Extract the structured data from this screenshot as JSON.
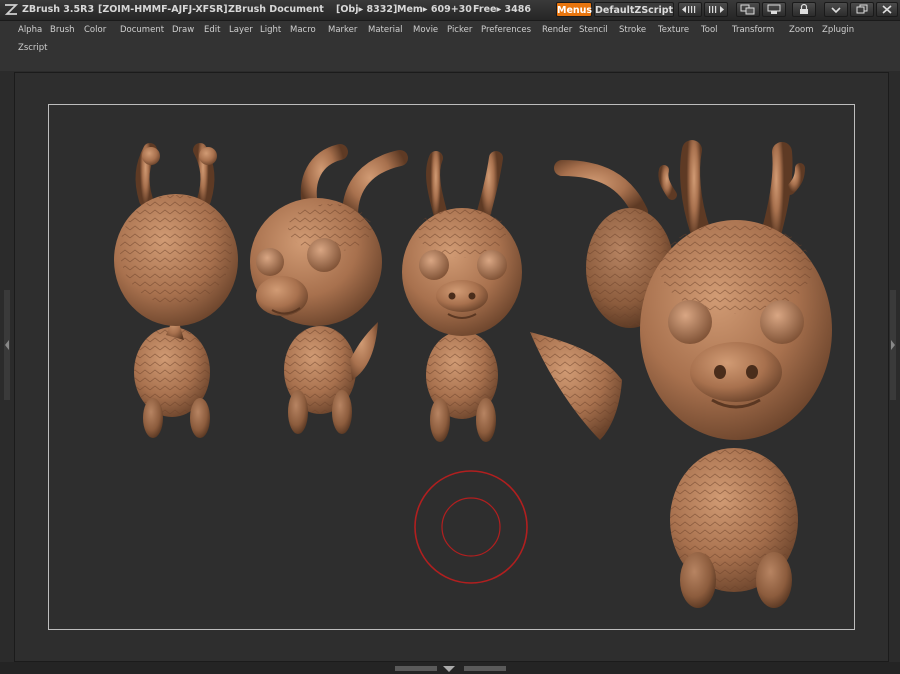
{
  "titlebar": {
    "app_version": "ZBrush 3.5R3",
    "serial": "[ZOIM-HMMF-AJFJ-XFSR]",
    "document": "ZBrush Document",
    "obj_label": "[Obj▸ 8332]",
    "mem_label": "Mem▸ 609+30",
    "free_label": "Free▸ 3486",
    "menus_button": "Menus",
    "script_button": "DefaultZScript"
  },
  "menus": [
    "Alpha",
    "Brush",
    "Color",
    "Document",
    "Draw",
    "Edit",
    "Layer",
    "Light",
    "Macro",
    "Marker",
    "Material",
    "Movie",
    "Picker",
    "Preferences",
    "Render",
    "Stencil",
    "Stroke",
    "Texture",
    "Tool",
    "Transform",
    "Zoom",
    "Zplugin",
    "Zscript"
  ],
  "colors": {
    "accent_orange": "#e8750e",
    "clay": "#a8714e",
    "brush_ring": "#b11f1f"
  },
  "icons": [
    "zbrush-logo-icon",
    "palette-left-icon",
    "palette-right-icon",
    "layout-icon",
    "layout-2-icon",
    "lock-icon",
    "minimize-icon",
    "restore-icon",
    "close-icon"
  ]
}
